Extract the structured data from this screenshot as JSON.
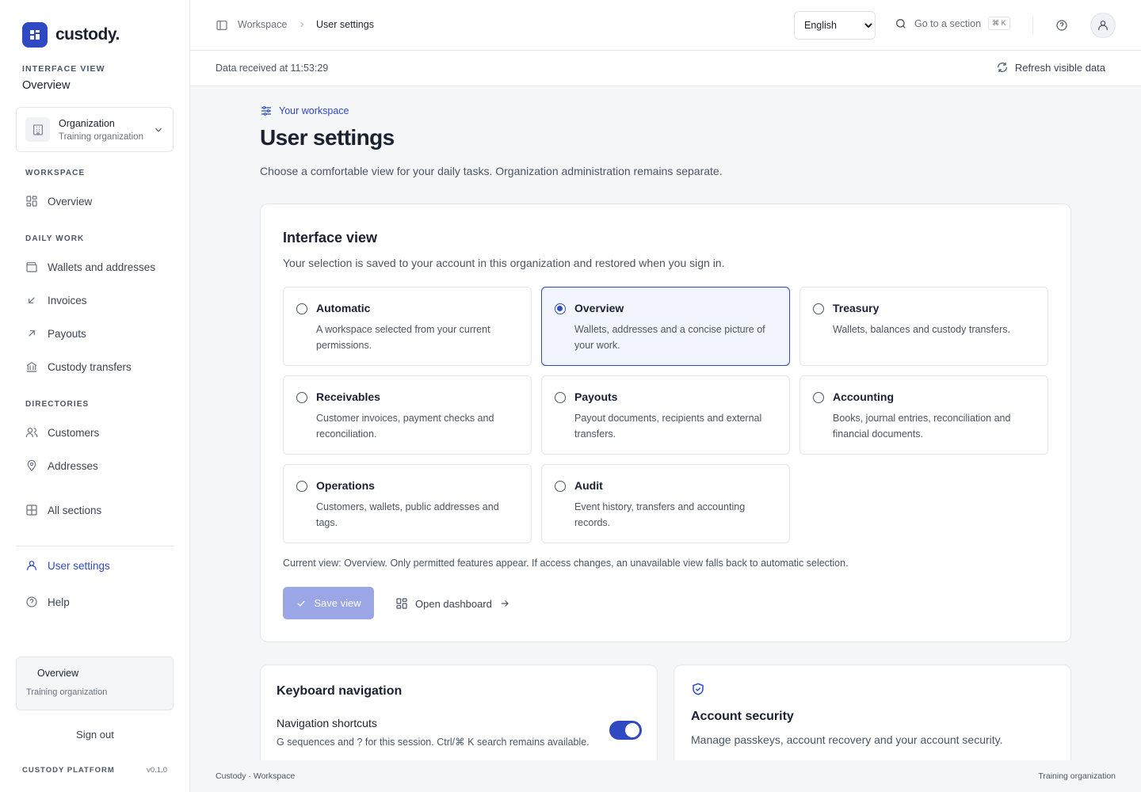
{
  "app": {
    "name": "custody.",
    "platform": "CUSTODY PLATFORM",
    "version": "v0.1.0"
  },
  "sidebar": {
    "interface_view_label": "INTERFACE VIEW",
    "interface_view_value": "Overview",
    "organization": {
      "title": "Organization",
      "subtitle": "Training organization"
    },
    "sections": {
      "workspace": "WORKSPACE",
      "daily_work": "DAILY WORK",
      "directories": "DIRECTORIES"
    },
    "items": {
      "overview": {
        "label": "Overview",
        "icon": "grid-icon"
      },
      "wallets": {
        "label": "Wallets and addresses",
        "icon": "wallet-icon"
      },
      "invoices": {
        "label": "Invoices",
        "icon": "arrow-down-left-icon"
      },
      "payouts": {
        "label": "Payouts",
        "icon": "arrow-up-right-icon"
      },
      "custody_transfers": {
        "label": "Custody transfers",
        "icon": "bank-icon"
      },
      "customers": {
        "label": "Customers",
        "icon": "users-icon"
      },
      "addresses": {
        "label": "Addresses",
        "icon": "map-pin-icon"
      },
      "all_sections": {
        "label": "All sections",
        "icon": "table-grid-icon"
      },
      "user_settings": {
        "label": "User settings",
        "icon": "user-icon"
      },
      "help": {
        "label": "Help",
        "icon": "help-circle-icon"
      }
    },
    "context": {
      "title": "Overview",
      "subtitle": "Training organization"
    },
    "sign_out": "Sign out"
  },
  "topbar": {
    "breadcrumb": [
      "Workspace",
      "User settings"
    ],
    "language": {
      "selected": "English",
      "options": [
        "English"
      ]
    },
    "search": {
      "label": "Go to a section",
      "shortcut": "⌘ K"
    }
  },
  "databar": {
    "received": "Data received at 11:53:29",
    "refresh": "Refresh visible data"
  },
  "page": {
    "eyebrow": "Your workspace",
    "title": "User settings",
    "description": "Choose a comfortable view for your daily tasks. Organization administration remains separate."
  },
  "interface_view": {
    "title": "Interface view",
    "description": "Your selection is saved to your account in this organization and restored when you sign in.",
    "options": [
      {
        "title": "Automatic",
        "description": "A workspace selected from your current permissions.",
        "selected": false
      },
      {
        "title": "Overview",
        "description": "Wallets, addresses and a concise picture of your work.",
        "selected": true
      },
      {
        "title": "Treasury",
        "description": "Wallets, balances and custody transfers.",
        "selected": false
      },
      {
        "title": "Receivables",
        "description": "Customer invoices, payment checks and reconciliation.",
        "selected": false
      },
      {
        "title": "Payouts",
        "description": "Payout documents, recipients and external transfers.",
        "selected": false
      },
      {
        "title": "Accounting",
        "description": "Books, journal entries, reconciliation and financial documents.",
        "selected": false
      },
      {
        "title": "Operations",
        "description": "Customers, wallets, public addresses and tags.",
        "selected": false
      },
      {
        "title": "Audit",
        "description": "Event history, transfers and accounting records.",
        "selected": false
      }
    ],
    "current_view_note": "Current view: Overview. Only permitted features appear. If access changes, an unavailable view falls back to automatic selection.",
    "save_label": "Save view",
    "dashboard_label": "Open dashboard"
  },
  "keyboard": {
    "title": "Keyboard navigation",
    "shortcut_title": "Navigation shortcuts",
    "shortcut_desc": "G sequences and ? for this session. Ctrl/⌘ K search remains available.",
    "enabled": true
  },
  "security": {
    "title": "Account security",
    "description": "Manage passkeys, account recovery and your account security."
  },
  "footer": {
    "left": "Custody · Workspace",
    "right": "Training organization"
  },
  "colors": {
    "accent": "#2f49c2",
    "accent_soft": "#f3f5fe",
    "save_disabled": "#9aa6e6"
  }
}
